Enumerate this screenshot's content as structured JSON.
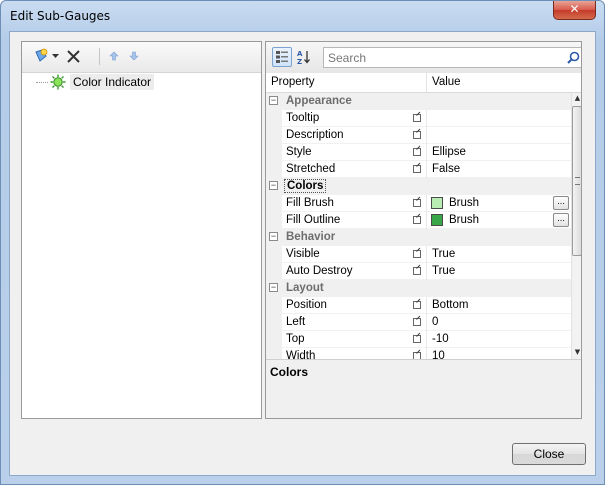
{
  "window": {
    "title": "Edit Sub-Gauges",
    "close_glyph": "✕"
  },
  "left_panel": {
    "toolbar": {
      "icons": [
        "add-gauge-icon",
        "dropdown-arrow-icon",
        "delete-icon",
        "move-up-icon",
        "move-down-icon"
      ]
    },
    "tree": {
      "items": [
        {
          "label": "Color Indicator",
          "icon": "indicator-icon"
        }
      ]
    }
  },
  "property_grid": {
    "toolbar": {
      "icons": [
        "categorized-view-icon",
        "alphabetical-sort-icon",
        "search-icon"
      ]
    },
    "search": {
      "placeholder": "Search",
      "value": ""
    },
    "headers": {
      "property": "Property",
      "value": "Value"
    },
    "categories": [
      {
        "name": "Appearance",
        "properties": [
          {
            "name": "Tooltip",
            "value": ""
          },
          {
            "name": "Description",
            "value": ""
          },
          {
            "name": "Style",
            "value": "Ellipse"
          },
          {
            "name": "Stretched",
            "value": "False"
          }
        ]
      },
      {
        "name": "Colors",
        "properties": [
          {
            "name": "Fill Brush",
            "value": "Brush",
            "swatch": "#b9ecb2"
          },
          {
            "name": "Fill Outline",
            "value": "Brush",
            "swatch": "#3aa64a"
          }
        ]
      },
      {
        "name": "Behavior",
        "properties": [
          {
            "name": "Visible",
            "value": "True"
          },
          {
            "name": "Auto Destroy",
            "value": "True"
          }
        ]
      },
      {
        "name": "Layout",
        "properties": [
          {
            "name": "Position",
            "value": "Bottom"
          },
          {
            "name": "Left",
            "value": "0"
          },
          {
            "name": "Top",
            "value": "-10"
          },
          {
            "name": "Width",
            "value": "10"
          }
        ]
      }
    ],
    "ellipsis_label": "...",
    "description": {
      "title": "Colors"
    }
  },
  "footer": {
    "close_label": "Close"
  }
}
